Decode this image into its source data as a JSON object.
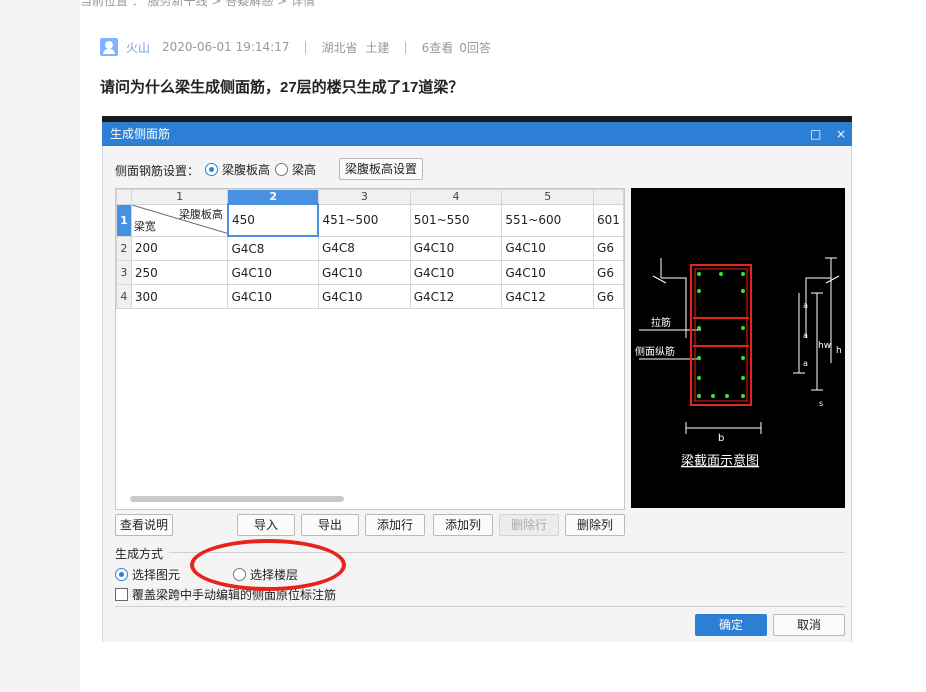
{
  "breadcrumb": "当前位置 ： 服务新干线 > 答疑解惑 > 详情",
  "post": {
    "user": "火山",
    "datetime": "2020-06-01 19:14:17",
    "region": "湖北省",
    "category": "土建",
    "views": "6查看",
    "answers": "0回答",
    "separator": "|",
    "title": "请问为什么梁生成侧面筋，27层的楼只生成了17道梁？"
  },
  "dialog": {
    "title": "生成侧面筋",
    "maximize_icon": "□",
    "close_icon": "×",
    "setting_label": "侧面钢筋设置：",
    "radio_web_height": "梁腹板高",
    "radio_beam_height": "梁高",
    "web_height_button": "梁腹板高设置",
    "grid": {
      "col_numbers": [
        "1",
        "2",
        "3",
        "4",
        "5",
        ""
      ],
      "corner_top": "梁腹板高",
      "corner_bottom": "梁宽",
      "header_values": [
        "450",
        "451~500",
        "501~550",
        "551~600",
        "601"
      ],
      "rows": [
        {
          "num": "2",
          "width": "200",
          "cells": [
            "G4C8",
            "G4C8",
            "G4C10",
            "G4C10",
            "G6"
          ]
        },
        {
          "num": "3",
          "width": "250",
          "cells": [
            "G4C10",
            "G4C10",
            "G4C10",
            "G4C10",
            "G6"
          ]
        },
        {
          "num": "4",
          "width": "300",
          "cells": [
            "G4C10",
            "G4C10",
            "G4C12",
            "G4C12",
            "G6"
          ]
        }
      ]
    },
    "preview": {
      "tie_label": "拉筋",
      "side_label": "侧面纵筋",
      "caption": "梁截面示意图",
      "dim_b": "b",
      "dim_hw": "hw",
      "dim_h": "h",
      "dim_a": "a",
      "dim_s": "s"
    },
    "buttons": {
      "help": "查看说明",
      "import": "导入",
      "export": "导出",
      "add_row": "添加行",
      "add_col": "添加列",
      "del_row": "删除行",
      "del_col": "删除列",
      "ok": "确定",
      "cancel": "取消"
    },
    "mode_label": "生成方式",
    "mode_select_element": "选择图元",
    "mode_select_floor": "选择楼层",
    "overwrite_label": "覆盖梁跨中手动编辑的侧面原位标注筋"
  }
}
